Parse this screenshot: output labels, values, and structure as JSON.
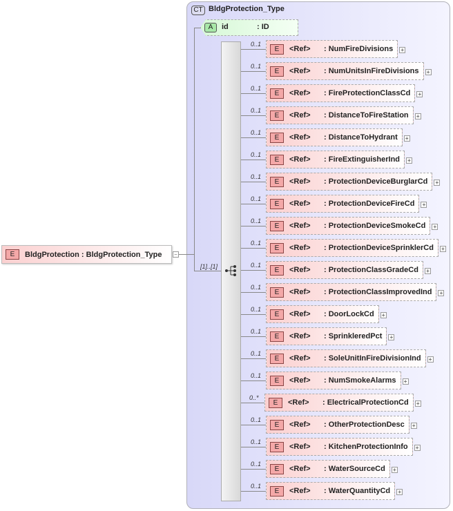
{
  "main_element": {
    "badge": "E",
    "name": "BldgProtection",
    "type": ": BldgProtection_Type",
    "collapse": "−"
  },
  "complex_type": {
    "badge": "CT",
    "name": "BldgProtection_Type"
  },
  "attribute": {
    "badge": "A",
    "name": "id",
    "type": ": ID"
  },
  "sequence": {
    "cardinality": "[1]..[1]"
  },
  "children": [
    {
      "card": "0..1",
      "ref": "<Ref>",
      "name": ": NumFireDivisions"
    },
    {
      "card": "0..1",
      "ref": "<Ref>",
      "name": ": NumUnitsInFireDivisions"
    },
    {
      "card": "0..1",
      "ref": "<Ref>",
      "name": ": FireProtectionClassCd"
    },
    {
      "card": "0..1",
      "ref": "<Ref>",
      "name": ": DistanceToFireStation"
    },
    {
      "card": "0..1",
      "ref": "<Ref>",
      "name": ": DistanceToHydrant"
    },
    {
      "card": "0..1",
      "ref": "<Ref>",
      "name": ": FireExtinguisherInd"
    },
    {
      "card": "0..1",
      "ref": "<Ref>",
      "name": ": ProtectionDeviceBurglarCd"
    },
    {
      "card": "0..1",
      "ref": "<Ref>",
      "name": ": ProtectionDeviceFireCd"
    },
    {
      "card": "0..1",
      "ref": "<Ref>",
      "name": ": ProtectionDeviceSmokeCd"
    },
    {
      "card": "0..1",
      "ref": "<Ref>",
      "name": ": ProtectionDeviceSprinklerCd"
    },
    {
      "card": "0..1",
      "ref": "<Ref>",
      "name": ": ProtectionClassGradeCd"
    },
    {
      "card": "0..1",
      "ref": "<Ref>",
      "name": ": ProtectionClassImprovedInd"
    },
    {
      "card": "0..1",
      "ref": "<Ref>",
      "name": ": DoorLockCd"
    },
    {
      "card": "0..1",
      "ref": "<Ref>",
      "name": ": SprinkleredPct"
    },
    {
      "card": "0..1",
      "ref": "<Ref>",
      "name": ": SoleUnitInFireDivisionInd"
    },
    {
      "card": "0..1",
      "ref": "<Ref>",
      "name": ": NumSmokeAlarms"
    },
    {
      "card": "0..*",
      "ref": "<Ref>",
      "name": ": ElectricalProtectionCd"
    },
    {
      "card": "0..1",
      "ref": "<Ref>",
      "name": ": OtherProtectionDesc"
    },
    {
      "card": "0..1",
      "ref": "<Ref>",
      "name": ": KitchenProtectionInfo"
    },
    {
      "card": "0..1",
      "ref": "<Ref>",
      "name": ": WaterSourceCd"
    },
    {
      "card": "0..1",
      "ref": "<Ref>",
      "name": ": WaterQuantityCd"
    }
  ]
}
